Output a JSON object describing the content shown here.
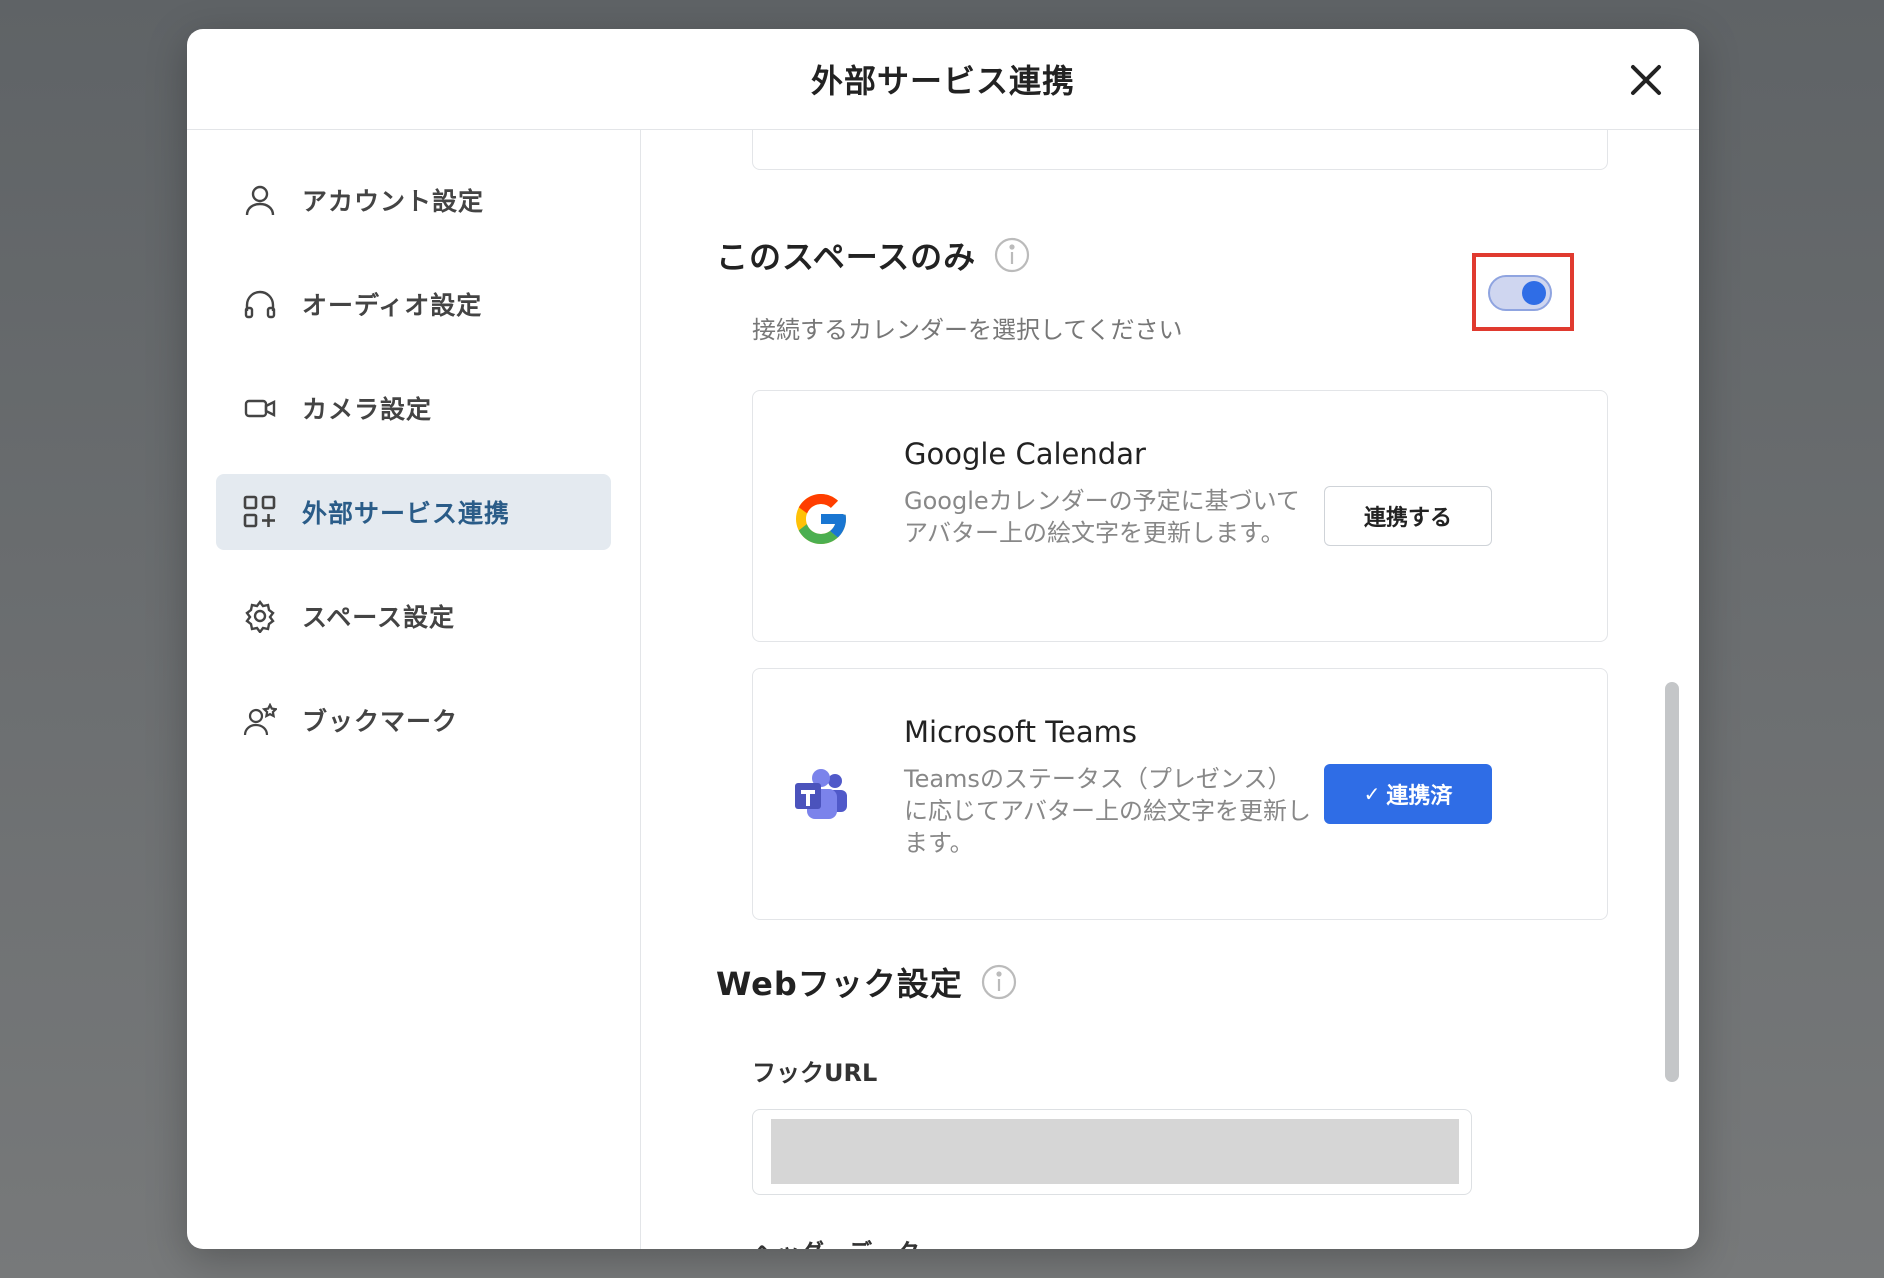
{
  "modal": {
    "title": "外部サービス連携",
    "close_icon": "close-icon"
  },
  "sidebar": {
    "items": [
      {
        "label": "アカウント設定",
        "icon": "user-icon",
        "active": false
      },
      {
        "label": "オーディオ設定",
        "icon": "headphones-icon",
        "active": false
      },
      {
        "label": "カメラ設定",
        "icon": "video-camera-icon",
        "active": false
      },
      {
        "label": "外部サービス連携",
        "icon": "apps-add-icon",
        "active": true
      },
      {
        "label": "スペース設定",
        "icon": "gear-icon",
        "active": false
      },
      {
        "label": "ブックマーク",
        "icon": "user-star-icon",
        "active": false
      }
    ]
  },
  "space_only": {
    "title": "このスペースのみ",
    "subtitle": "接続するカレンダーを選択してください",
    "toggle_on": true
  },
  "services": [
    {
      "name": "Google Calendar",
      "description": "Googleカレンダーの予定に基づいてアバター上の絵文字を更新します。",
      "button_label": "連携する",
      "connected": false
    },
    {
      "name": "Microsoft Teams",
      "description": "Teamsのステータス（プレゼンス）に応じてアバター上の絵文字を更新します。",
      "button_label": "連携済",
      "connected": true
    }
  ],
  "webhook": {
    "title": "Webフック設定",
    "url_label": "フックURL",
    "header_label": "ヘッダーデータ"
  },
  "colors": {
    "accent": "#2f6de6",
    "highlight": "#e03a2f",
    "active_nav_bg": "#e4eaf0"
  }
}
